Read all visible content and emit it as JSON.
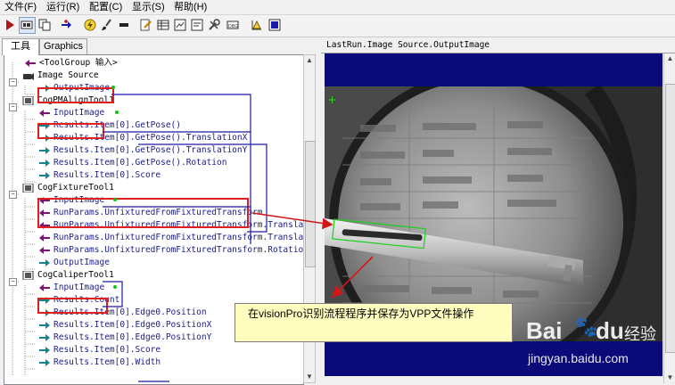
{
  "menu": [
    {
      "id": "file",
      "label": "文件(F)"
    },
    {
      "id": "run",
      "label": "运行(R)"
    },
    {
      "id": "config",
      "label": "配置(C)"
    },
    {
      "id": "view",
      "label": "显示(S)"
    },
    {
      "id": "help",
      "label": "帮助(H)"
    }
  ],
  "toolbar": [
    "run-icon",
    "toolgroup-view-icon",
    "copy-icon",
    "add-terminal-icon",
    "lightning-icon",
    "brush-icon",
    "remove-icon",
    "edit-icon",
    "results-grid-icon",
    "image-icon",
    "wrench-icon",
    "dbg-icon",
    "warning-sort-icon",
    "output-icon"
  ],
  "left_tabs": [
    {
      "label": "工具"
    },
    {
      "label": "Graphics"
    }
  ],
  "tree": {
    "rows": [
      {
        "label": "<ToolGroup 输入>",
        "icon": "input-arrow",
        "color": "#7a1470"
      },
      {
        "label": "Image Source",
        "icon": "camera",
        "color": "#000000"
      },
      {
        "label": "OutputImage",
        "icon": "output-arrow",
        "color": "#16828a"
      },
      {
        "label": "CogPMAlignTool1",
        "icon": "tool",
        "color": "#000000"
      },
      {
        "label": "InputImage",
        "icon": "input-arrow",
        "color": "#7a1470"
      },
      {
        "label": "Results.Item[0].GetPose()",
        "icon": "output-arrow",
        "color": "#16828a"
      },
      {
        "label": "Results.Item[0].GetPose().TranslationX",
        "icon": "output-arrow",
        "color": "#16828a"
      },
      {
        "label": "Results.Item[0].GetPose().TranslationY",
        "icon": "output-arrow",
        "color": "#16828a"
      },
      {
        "label": "Results.Item[0].GetPose().Rotation",
        "icon": "output-arrow",
        "color": "#16828a"
      },
      {
        "label": "Results.Item[0].Score",
        "icon": "output-arrow",
        "color": "#16828a"
      },
      {
        "label": "CogFixtureTool1",
        "icon": "tool",
        "color": "#000000"
      },
      {
        "label": "InputImage",
        "icon": "input-arrow",
        "color": "#7a1470"
      },
      {
        "label": "RunParams.UnfixturedFromFixturedTransform",
        "icon": "input-arrow",
        "color": "#7a1470"
      },
      {
        "label": "RunParams.UnfixturedFromFixturedTransform.Translation",
        "icon": "input-arrow",
        "color": "#7a1470"
      },
      {
        "label": "RunParams.UnfixturedFromFixturedTransform.Translation",
        "icon": "input-arrow",
        "color": "#7a1470"
      },
      {
        "label": "RunParams.UnfixturedFromFixturedTransform.Rotation",
        "icon": "input-arrow",
        "color": "#7a1470"
      },
      {
        "label": "OutputImage",
        "icon": "output-arrow",
        "color": "#16828a"
      },
      {
        "label": "CogCaliperTool1",
        "icon": "tool",
        "color": "#000000"
      },
      {
        "label": "InputImage",
        "icon": "input-arrow",
        "color": "#7a1470"
      },
      {
        "label": "Results.Count",
        "icon": "output-arrow",
        "color": "#16828a"
      },
      {
        "label": "Results.Item[0].Edge0.Position",
        "icon": "output-arrow",
        "color": "#16828a"
      },
      {
        "label": "Results.Item[0].Edge0.PositionX",
        "icon": "output-arrow",
        "color": "#16828a"
      },
      {
        "label": "Results.Item[0].Edge0.PositionY",
        "icon": "output-arrow",
        "color": "#16828a"
      },
      {
        "label": "Results.Item[0].Score",
        "icon": "output-arrow",
        "color": "#16828a"
      },
      {
        "label": "Results.Item[0].Width",
        "icon": "output-arrow",
        "color": "#16828a"
      }
    ]
  },
  "right_pane": {
    "title": "LastRun.Image Source.OutputImage"
  },
  "callout": {
    "text": "在visionPro识别流程程序并保存为VPP文件操作"
  },
  "watermark": {
    "brand_a": "Bai",
    "brand_b": "du",
    "brand_c": "经验",
    "url": "jingyan.baidu.com"
  },
  "colors": {
    "input_arrow": "#7a1470",
    "output_arrow": "#16828a",
    "highlight": "#e0201c",
    "connector": "#1a1aa8",
    "viewer_bg": "#0a0a78",
    "callout_bg": "#fffcbf"
  }
}
